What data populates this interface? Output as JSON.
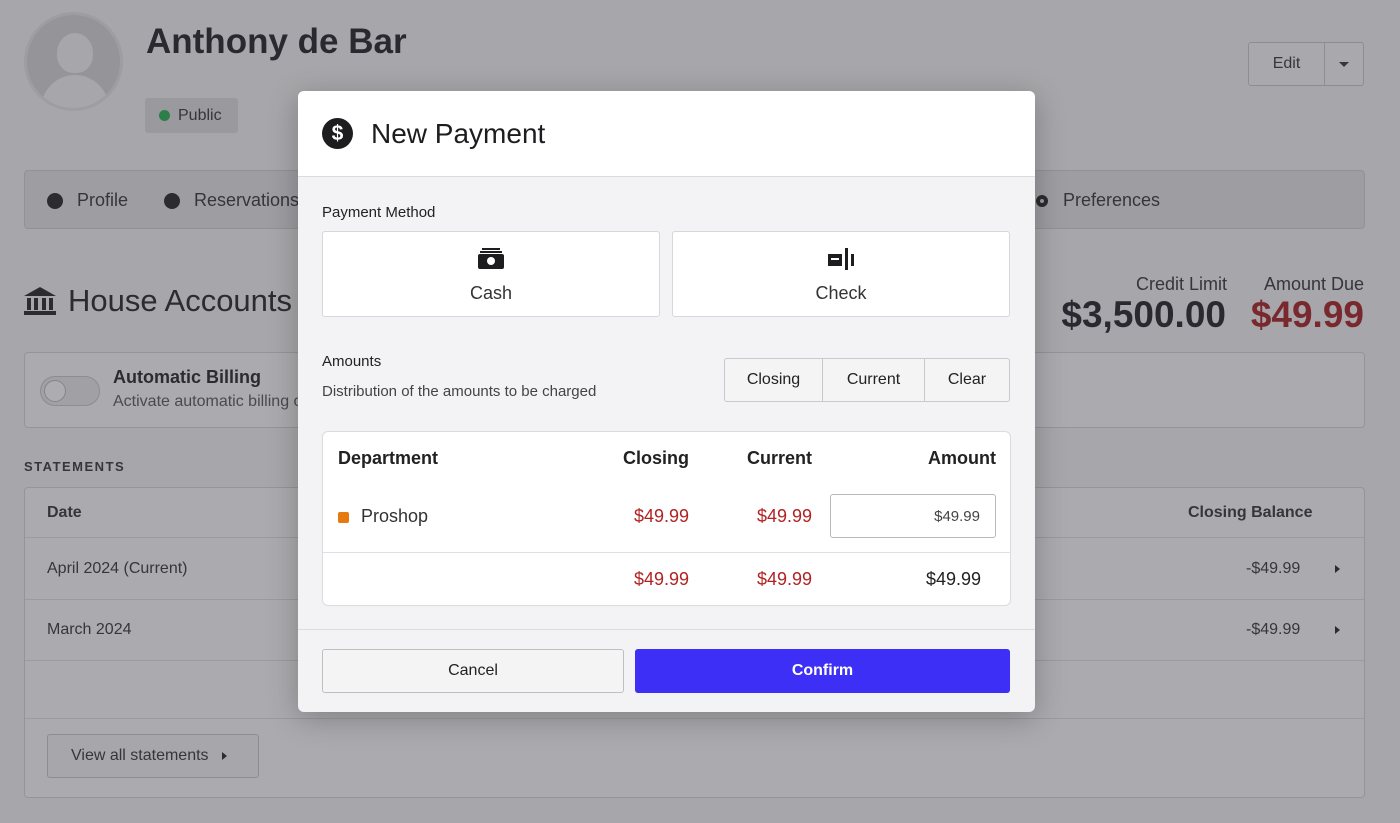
{
  "profile": {
    "name": "Anthony de Bar",
    "visibility": "Public",
    "edit_label": "Edit"
  },
  "nav": {
    "tabs": [
      {
        "label": "Profile"
      },
      {
        "label": "Reservations"
      },
      {
        "label": "Preferences"
      }
    ]
  },
  "house_accounts": {
    "title": "House Accounts",
    "credit_limit_label": "Credit Limit",
    "credit_limit_value": "$3,500.00",
    "amount_due_label": "Amount Due",
    "amount_due_value": "$49.99",
    "billing": {
      "title": "Automatic Billing",
      "description": "Activate automatic billing o",
      "enabled": false
    }
  },
  "statements": {
    "section_label": "STATEMENTS",
    "columns": {
      "date": "Date",
      "closing_balance": "Closing Balance"
    },
    "rows": [
      {
        "date": "April 2024 (Current)",
        "closing_balance": "-$49.99"
      },
      {
        "date": "March 2024",
        "closing_balance": "-$49.99"
      }
    ],
    "view_all_label": "View all statements"
  },
  "modal": {
    "title": "New Payment",
    "payment_method_label": "Payment Method",
    "methods": [
      {
        "label": "Cash",
        "icon": "cash-icon"
      },
      {
        "label": "Check",
        "icon": "check-icon"
      }
    ],
    "amounts_label": "Amounts",
    "amounts_description": "Distribution of the amounts to be charged",
    "distribution_buttons": [
      "Closing",
      "Current",
      "Clear"
    ],
    "table": {
      "columns": {
        "department": "Department",
        "closing": "Closing",
        "current": "Current",
        "amount": "Amount"
      },
      "rows": [
        {
          "department": "Proshop",
          "dept_color": "#e57a0e",
          "closing": "$49.99",
          "current": "$49.99",
          "amount": "$49.99"
        }
      ],
      "totals": {
        "closing": "$49.99",
        "current": "$49.99",
        "amount": "$49.99"
      }
    },
    "cancel_label": "Cancel",
    "confirm_label": "Confirm"
  },
  "colors": {
    "accent": "#3d2ff5",
    "negative": "#b22222",
    "status_public": "#22b04b"
  }
}
